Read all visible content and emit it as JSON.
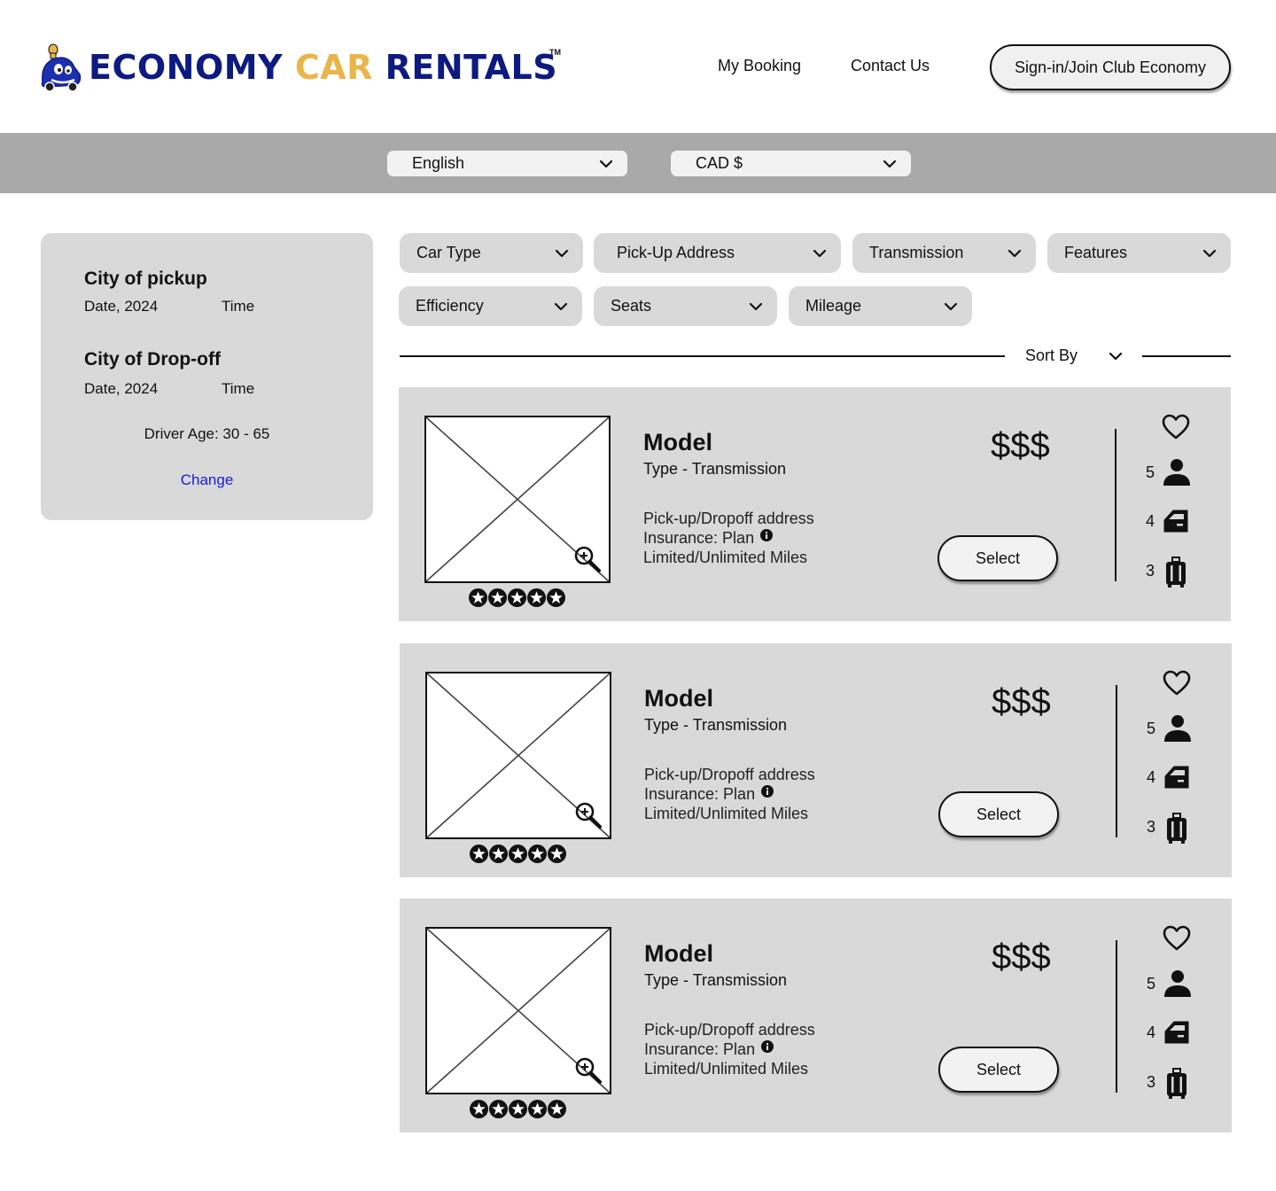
{
  "brand": {
    "word1": "ECONOMY",
    "word2": "CAR",
    "word3": "RENTALS",
    "tm": "TM",
    "colors": {
      "primary": "#0d1a80",
      "accent": "#e8b54a"
    }
  },
  "nav": {
    "my_booking": "My Booking",
    "contact_us": "Contact Us",
    "signin": "Sign-in/Join Club Economy"
  },
  "locale": {
    "language": "English",
    "currency": "CAD $"
  },
  "summary": {
    "pickup_city": "City of pickup",
    "pickup_date": "Date, 2024",
    "pickup_time": "Time",
    "dropoff_city": "City of Drop-off",
    "dropoff_date": "Date, 2024",
    "dropoff_time": "Time",
    "driver_age": "Driver Age: 30 - 65",
    "change": "Change"
  },
  "filters": [
    {
      "label": "Car Type"
    },
    {
      "label": "Pick-Up Address"
    },
    {
      "label": "Transmission"
    },
    {
      "label": "Features"
    },
    {
      "label": "Efficiency"
    },
    {
      "label": "Seats"
    },
    {
      "label": "Mileage"
    }
  ],
  "sort": {
    "label": "Sort By"
  },
  "results": [
    {
      "model": "Model",
      "type": "Type - Transmission",
      "address": "Pick-up/Dropoff address",
      "insurance": "Insurance: Plan",
      "miles": "Limited/Unlimited Miles",
      "price": "$$$",
      "select": "Select",
      "seats": "5",
      "doors": "4",
      "bags": "3",
      "rating_stars": 5
    },
    {
      "model": "Model",
      "type": "Type - Transmission",
      "address": "Pick-up/Dropoff address",
      "insurance": "Insurance: Plan",
      "miles": "Limited/Unlimited Miles",
      "price": "$$$",
      "select": "Select",
      "seats": "5",
      "doors": "4",
      "bags": "3",
      "rating_stars": 5
    },
    {
      "model": "Model",
      "type": "Type - Transmission",
      "address": "Pick-up/Dropoff address",
      "insurance": "Insurance: Plan",
      "miles": "Limited/Unlimited Miles",
      "price": "$$$",
      "select": "Select",
      "seats": "5",
      "doors": "4",
      "bags": "3",
      "rating_stars": 5
    }
  ],
  "icons": [
    "mascot-logo-icon",
    "chevron-down-icon",
    "zoom-in-icon",
    "star-icon",
    "info-icon",
    "heart-icon",
    "person-icon",
    "car-door-icon",
    "luggage-icon"
  ]
}
